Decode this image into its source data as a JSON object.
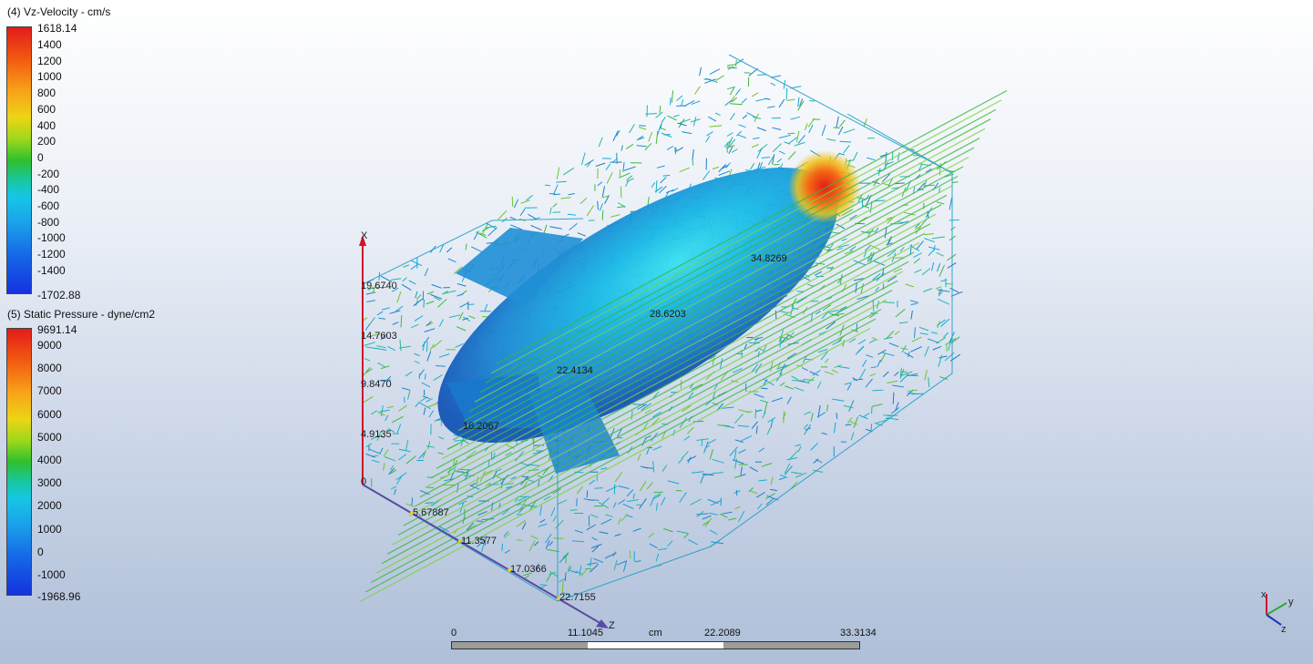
{
  "legend_velocity": {
    "title": "(4) Vz-Velocity - cm/s",
    "max": "1618.14",
    "min": "-1702.88",
    "ticks": [
      "1400",
      "1200",
      "1000",
      "800",
      "600",
      "400",
      "200",
      "0",
      "-200",
      "-400",
      "-600",
      "-800",
      "-1000",
      "-1200",
      "-1400"
    ]
  },
  "legend_pressure": {
    "title": "(5) Static Pressure - dyne/cm2",
    "max": "9691.14",
    "min": "-1968.96",
    "ticks": [
      "9000",
      "8000",
      "7000",
      "6000",
      "5000",
      "4000",
      "3000",
      "2000",
      "1000",
      "0",
      "-1000"
    ]
  },
  "axes": {
    "x_axis_name": "X",
    "z_axis_name": "Z",
    "x_ticks": [
      "19.6740",
      "14.7603",
      "9.8470",
      "4.9135",
      "0"
    ],
    "z_ticks": [
      "5.67887",
      "11.3577",
      "17.0366",
      "22.7155"
    ]
  },
  "probe_labels": {
    "a": "34.8269",
    "b": "28.6203",
    "c": "22.4134",
    "d": "16.2067"
  },
  "scale": {
    "unit": "cm",
    "t0": "0",
    "t1": "11.1045",
    "t2": "22.2089",
    "t3": "33.3134"
  },
  "triad": {
    "x": "x",
    "y": "y",
    "z": "z"
  },
  "colors": {
    "rainbow_top": "#e8231c",
    "rainbow_bottom": "#1432e0",
    "axis_x": "#d0152b",
    "axis_z": "#5a4aa6",
    "streamline_green": "#3db83a",
    "body_blue": "#2a8fd6"
  }
}
